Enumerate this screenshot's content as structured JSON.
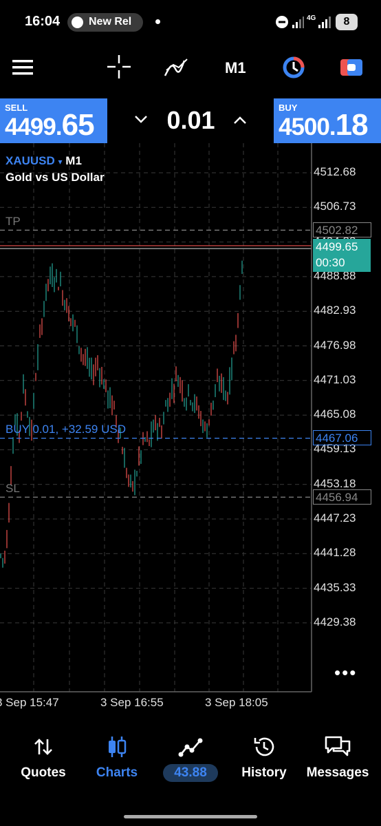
{
  "status_bar": {
    "time": "16:04",
    "notification": "New Rel",
    "network": "4G",
    "battery": "8"
  },
  "toolbar": {
    "timeframe": "M1",
    "icons": [
      "menu-icon",
      "crosshair-icon",
      "indicators-icon",
      "timeframe",
      "one-click-trading-icon",
      "chart-objects-icon"
    ]
  },
  "trade_panel": {
    "sell_label": "SELL",
    "sell_price_main": "4499.",
    "sell_price_big": "65",
    "buy_label": "BUY",
    "buy_price_main": "4500.",
    "buy_price_big": "18",
    "lot": "0.01"
  },
  "chart": {
    "symbol": "XAUUSD",
    "symbol_arrow": "▾",
    "timeframe": "M1",
    "description": "Gold vs US Dollar",
    "tp_label": "TP",
    "sl_label": "SL",
    "tp_price": "4502.82",
    "sl_price": "4456.94",
    "position_label": "BUY 0.01,  +32.59 USD",
    "position_price": "4467.06",
    "bid_price": "4499.65",
    "countdown": "00:30",
    "price_axis": [
      "4512.68",
      "4506.73",
      "4494.83",
      "4488.88",
      "4482.93",
      "4476.98",
      "4471.03",
      "4465.08",
      "4459.13",
      "4453.18",
      "4447.23",
      "4441.28",
      "4435.33",
      "4429.38"
    ],
    "time_axis": [
      "3 Sep 15:47",
      "3 Sep 16:55",
      "3 Sep 18:05"
    ],
    "more": "•••",
    "colors": {
      "bull": "#26a69a",
      "bear": "#ef5350",
      "accent": "#3d84f2",
      "grid": "#3a3a3a"
    }
  },
  "nav": {
    "items": [
      {
        "label": "Quotes",
        "icon": "quotes-icon"
      },
      {
        "label": "Charts",
        "icon": "charts-icon",
        "active": true
      },
      {
        "label": "43.88",
        "icon": "trade-icon"
      },
      {
        "label": "History",
        "icon": "history-icon"
      },
      {
        "label": "Messages",
        "icon": "messages-icon"
      }
    ]
  }
}
